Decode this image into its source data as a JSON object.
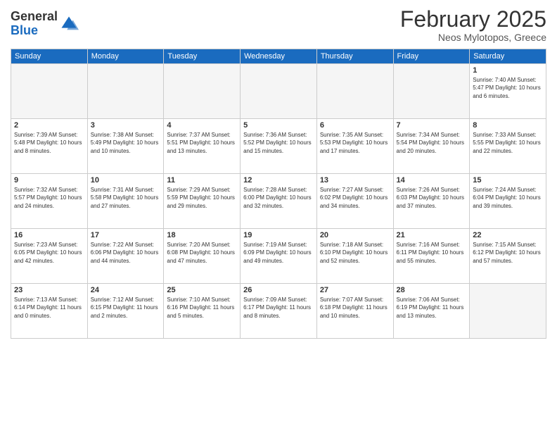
{
  "header": {
    "logo_general": "General",
    "logo_blue": "Blue",
    "month_year": "February 2025",
    "location": "Neos Mylotopos, Greece"
  },
  "weekdays": [
    "Sunday",
    "Monday",
    "Tuesday",
    "Wednesday",
    "Thursday",
    "Friday",
    "Saturday"
  ],
  "weeks": [
    [
      {
        "day": "",
        "info": ""
      },
      {
        "day": "",
        "info": ""
      },
      {
        "day": "",
        "info": ""
      },
      {
        "day": "",
        "info": ""
      },
      {
        "day": "",
        "info": ""
      },
      {
        "day": "",
        "info": ""
      },
      {
        "day": "1",
        "info": "Sunrise: 7:40 AM\nSunset: 5:47 PM\nDaylight: 10 hours\nand 6 minutes."
      }
    ],
    [
      {
        "day": "2",
        "info": "Sunrise: 7:39 AM\nSunset: 5:48 PM\nDaylight: 10 hours\nand 8 minutes."
      },
      {
        "day": "3",
        "info": "Sunrise: 7:38 AM\nSunset: 5:49 PM\nDaylight: 10 hours\nand 10 minutes."
      },
      {
        "day": "4",
        "info": "Sunrise: 7:37 AM\nSunset: 5:51 PM\nDaylight: 10 hours\nand 13 minutes."
      },
      {
        "day": "5",
        "info": "Sunrise: 7:36 AM\nSunset: 5:52 PM\nDaylight: 10 hours\nand 15 minutes."
      },
      {
        "day": "6",
        "info": "Sunrise: 7:35 AM\nSunset: 5:53 PM\nDaylight: 10 hours\nand 17 minutes."
      },
      {
        "day": "7",
        "info": "Sunrise: 7:34 AM\nSunset: 5:54 PM\nDaylight: 10 hours\nand 20 minutes."
      },
      {
        "day": "8",
        "info": "Sunrise: 7:33 AM\nSunset: 5:55 PM\nDaylight: 10 hours\nand 22 minutes."
      }
    ],
    [
      {
        "day": "9",
        "info": "Sunrise: 7:32 AM\nSunset: 5:57 PM\nDaylight: 10 hours\nand 24 minutes."
      },
      {
        "day": "10",
        "info": "Sunrise: 7:31 AM\nSunset: 5:58 PM\nDaylight: 10 hours\nand 27 minutes."
      },
      {
        "day": "11",
        "info": "Sunrise: 7:29 AM\nSunset: 5:59 PM\nDaylight: 10 hours\nand 29 minutes."
      },
      {
        "day": "12",
        "info": "Sunrise: 7:28 AM\nSunset: 6:00 PM\nDaylight: 10 hours\nand 32 minutes."
      },
      {
        "day": "13",
        "info": "Sunrise: 7:27 AM\nSunset: 6:02 PM\nDaylight: 10 hours\nand 34 minutes."
      },
      {
        "day": "14",
        "info": "Sunrise: 7:26 AM\nSunset: 6:03 PM\nDaylight: 10 hours\nand 37 minutes."
      },
      {
        "day": "15",
        "info": "Sunrise: 7:24 AM\nSunset: 6:04 PM\nDaylight: 10 hours\nand 39 minutes."
      }
    ],
    [
      {
        "day": "16",
        "info": "Sunrise: 7:23 AM\nSunset: 6:05 PM\nDaylight: 10 hours\nand 42 minutes."
      },
      {
        "day": "17",
        "info": "Sunrise: 7:22 AM\nSunset: 6:06 PM\nDaylight: 10 hours\nand 44 minutes."
      },
      {
        "day": "18",
        "info": "Sunrise: 7:20 AM\nSunset: 6:08 PM\nDaylight: 10 hours\nand 47 minutes."
      },
      {
        "day": "19",
        "info": "Sunrise: 7:19 AM\nSunset: 6:09 PM\nDaylight: 10 hours\nand 49 minutes."
      },
      {
        "day": "20",
        "info": "Sunrise: 7:18 AM\nSunset: 6:10 PM\nDaylight: 10 hours\nand 52 minutes."
      },
      {
        "day": "21",
        "info": "Sunrise: 7:16 AM\nSunset: 6:11 PM\nDaylight: 10 hours\nand 55 minutes."
      },
      {
        "day": "22",
        "info": "Sunrise: 7:15 AM\nSunset: 6:12 PM\nDaylight: 10 hours\nand 57 minutes."
      }
    ],
    [
      {
        "day": "23",
        "info": "Sunrise: 7:13 AM\nSunset: 6:14 PM\nDaylight: 11 hours\nand 0 minutes."
      },
      {
        "day": "24",
        "info": "Sunrise: 7:12 AM\nSunset: 6:15 PM\nDaylight: 11 hours\nand 2 minutes."
      },
      {
        "day": "25",
        "info": "Sunrise: 7:10 AM\nSunset: 6:16 PM\nDaylight: 11 hours\nand 5 minutes."
      },
      {
        "day": "26",
        "info": "Sunrise: 7:09 AM\nSunset: 6:17 PM\nDaylight: 11 hours\nand 8 minutes."
      },
      {
        "day": "27",
        "info": "Sunrise: 7:07 AM\nSunset: 6:18 PM\nDaylight: 11 hours\nand 10 minutes."
      },
      {
        "day": "28",
        "info": "Sunrise: 7:06 AM\nSunset: 6:19 PM\nDaylight: 11 hours\nand 13 minutes."
      },
      {
        "day": "",
        "info": ""
      }
    ]
  ]
}
